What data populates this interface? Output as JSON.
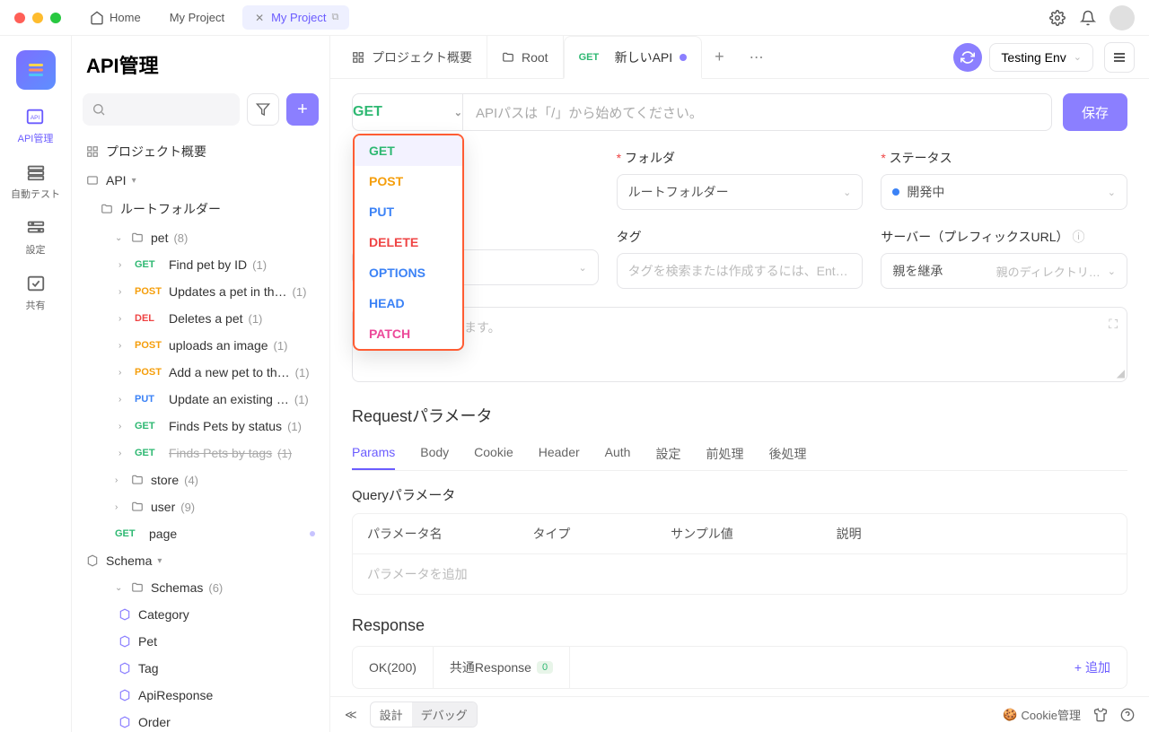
{
  "titlebar": {
    "tabs": [
      {
        "label": "Home",
        "icon": "home"
      },
      {
        "label": "My Project"
      },
      {
        "label": "My Project",
        "active": true
      }
    ]
  },
  "rail": {
    "items": [
      {
        "label": "API管理",
        "active": true
      },
      {
        "label": "自動テスト"
      },
      {
        "label": "設定"
      },
      {
        "label": "共有"
      }
    ]
  },
  "sidebar": {
    "title": "API管理",
    "project_overview": "プロジェクト概要",
    "api_section": "API",
    "root_folder": "ルートフォルダー",
    "tree": {
      "pet": {
        "name": "pet",
        "count": "(8)"
      },
      "pet_items": [
        {
          "method": "GET",
          "mclass": "m-get",
          "name": "Find pet by ID",
          "count": "(1)"
        },
        {
          "method": "POST",
          "mclass": "m-post",
          "name": "Updates a pet in th…",
          "count": "(1)"
        },
        {
          "method": "DEL",
          "mclass": "m-del",
          "name": "Deletes a pet",
          "count": "(1)"
        },
        {
          "method": "POST",
          "mclass": "m-post",
          "name": "uploads an image",
          "count": "(1)"
        },
        {
          "method": "POST",
          "mclass": "m-post",
          "name": "Add a new pet to th…",
          "count": "(1)"
        },
        {
          "method": "PUT",
          "mclass": "m-put",
          "name": "Update an existing …",
          "count": "(1)"
        },
        {
          "method": "GET",
          "mclass": "m-get",
          "name": "Finds Pets by status",
          "count": "(1)"
        },
        {
          "method": "GET",
          "mclass": "m-get",
          "name": "Finds Pets by tags",
          "count": "(1)",
          "strike": true
        }
      ],
      "store": {
        "name": "store",
        "count": "(4)"
      },
      "user": {
        "name": "user",
        "count": "(9)"
      },
      "page": {
        "method": "GET",
        "name": "page"
      },
      "schema_section": "Schema",
      "schemas": {
        "name": "Schemas",
        "count": "(6)"
      },
      "schema_items": [
        "Category",
        "Pet",
        "Tag",
        "ApiResponse",
        "Order"
      ]
    }
  },
  "main_tabs": [
    {
      "label": "プロジェクト概要",
      "icon": "overview"
    },
    {
      "label": "Root",
      "icon": "folder"
    },
    {
      "label": "新しいAPI",
      "method": "GET",
      "active": true,
      "dirty": true
    }
  ],
  "env": {
    "label": "Testing Env"
  },
  "path": {
    "method": "GET",
    "placeholder": "APIパスは「/」から始めてください。",
    "save": "保存"
  },
  "method_dropdown": [
    {
      "label": "GET",
      "class": "m-get",
      "selected": true
    },
    {
      "label": "POST",
      "class": "m-post"
    },
    {
      "label": "PUT",
      "class": "m-put"
    },
    {
      "label": "DELETE",
      "class": "m-delete"
    },
    {
      "label": "OPTIONS",
      "class": "m-options"
    },
    {
      "label": "HEAD",
      "class": "m-head"
    },
    {
      "label": "PATCH",
      "class": "m-patch"
    }
  ],
  "form": {
    "folder_label": "フォルダ",
    "folder_value": "ルートフォルダー",
    "status_label": "ステータス",
    "status_value": "開発中",
    "tag_label": "タグ",
    "tag_placeholder": "タグを検索または作成するには、Ent…",
    "server_label": "サーバー（プレフィックスURL）",
    "server_value": "親を継承",
    "server_hint": "親のディレクトリ…",
    "desc_placeholder": "マットが使用できます。"
  },
  "request": {
    "title": "Requestパラメータ",
    "tabs": [
      "Params",
      "Body",
      "Cookie",
      "Header",
      "Auth",
      "設定",
      "前処理",
      "後処理"
    ],
    "query_title": "Queryパラメータ",
    "columns": [
      "パラメータ名",
      "タイプ",
      "サンプル値",
      "説明"
    ],
    "empty": "パラメータを追加"
  },
  "response": {
    "title": "Response",
    "ok": "OK(200)",
    "common": "共通Response",
    "common_count": "0",
    "add": "追加"
  },
  "footer": {
    "design": "設計",
    "debug": "デバッグ",
    "cookie": "Cookie管理"
  }
}
